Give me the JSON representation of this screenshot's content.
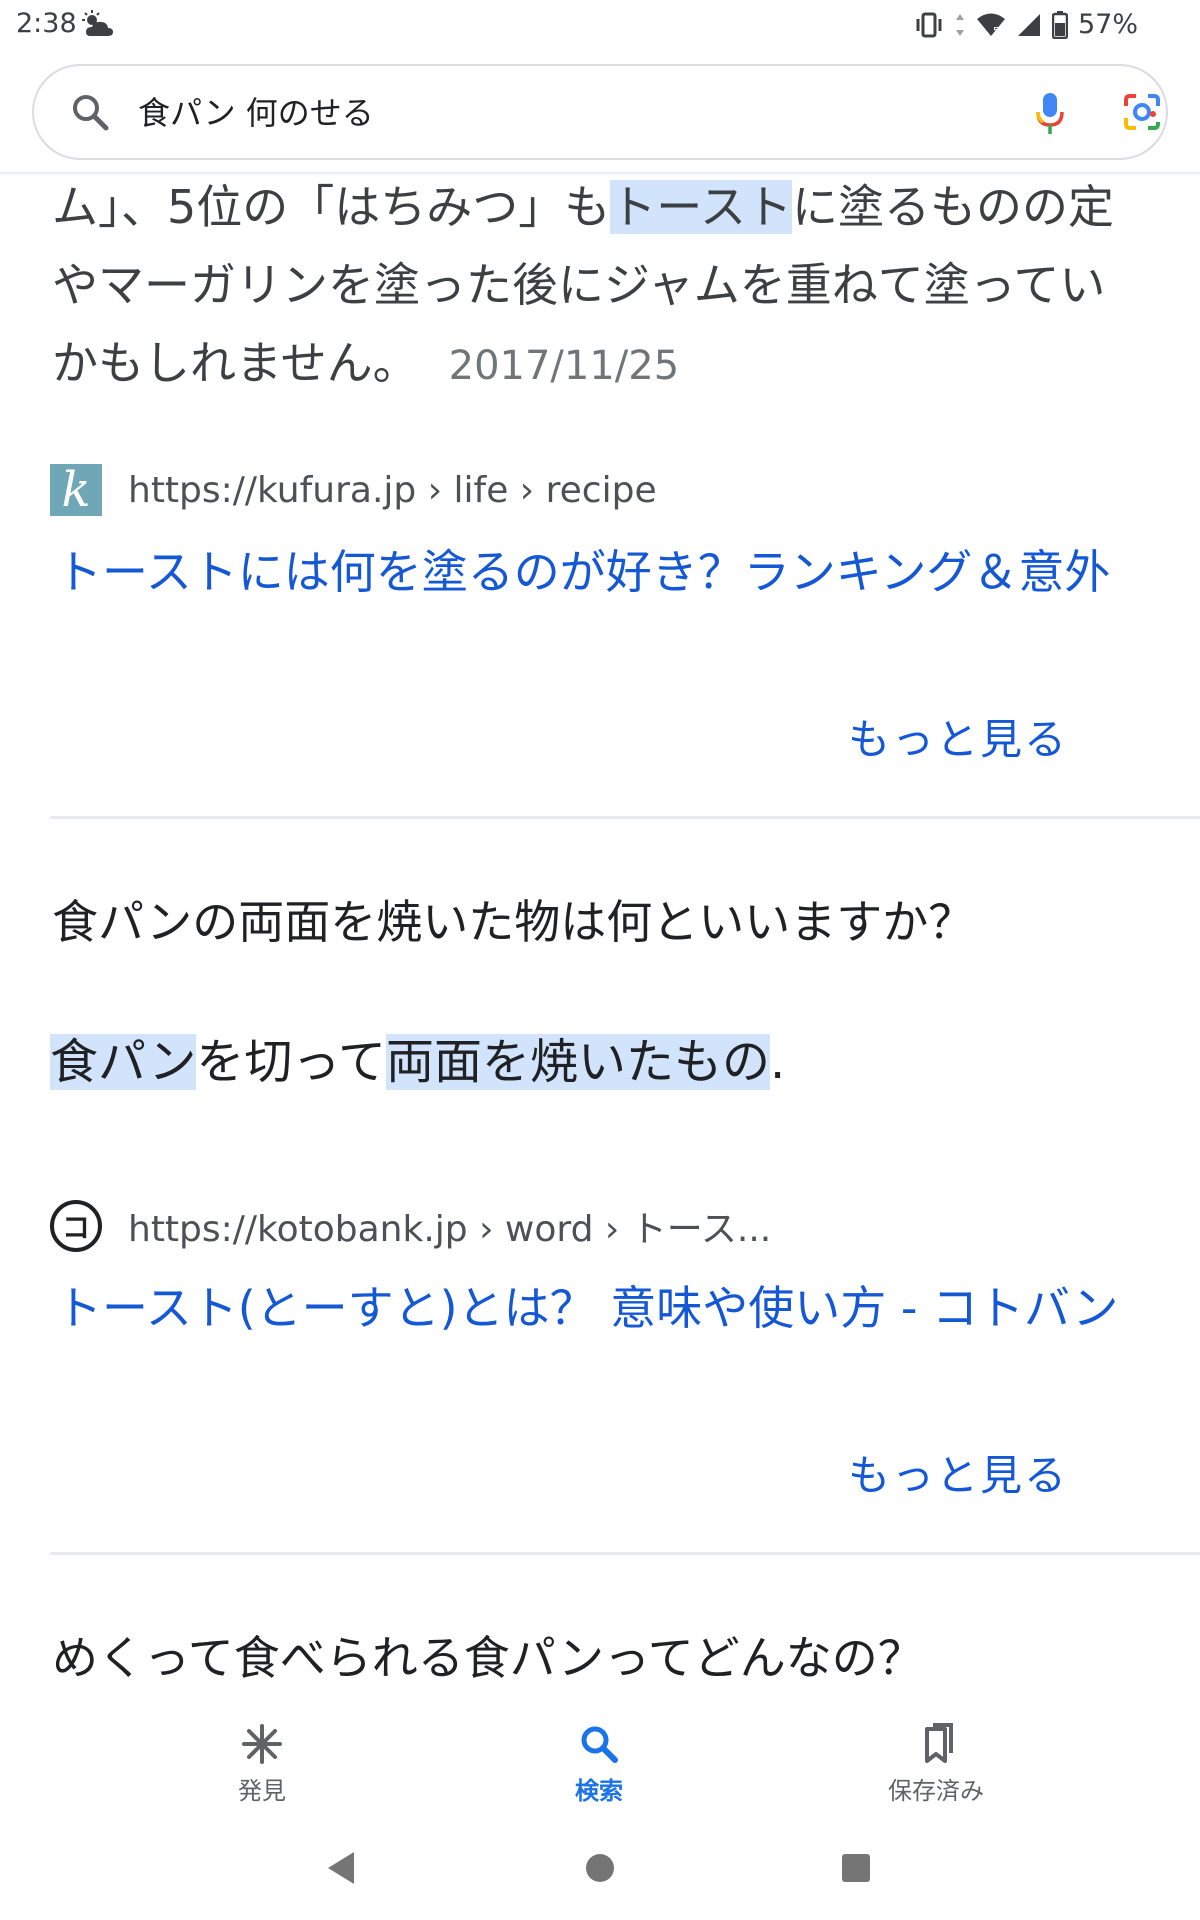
{
  "status_bar": {
    "time": "2:38",
    "battery": "57%"
  },
  "search": {
    "query": "食パン 何のせる",
    "icons": [
      "search-icon",
      "mic-icon",
      "lens-icon"
    ]
  },
  "snippet": {
    "line1_a": "ム」、5位の「はちみつ」も",
    "line1_hl": "トースト",
    "line1_b": "に塗るものの定",
    "line2": "やマーガリンを塗った後にジャムを重ねて塗ってい",
    "line3": "かもしれません。",
    "date": "2017/11/25"
  },
  "result1": {
    "url": "https://kufura.jp › life › recipe",
    "favicon_letter": "k",
    "title": "トーストには何を塗るのが好き？ランキング＆意外",
    "more": "もっと見る"
  },
  "question1": {
    "text": "食パンの両面を焼いた物は何といいますか？",
    "answer_hl1": "食パン",
    "answer_mid": "を切って",
    "answer_hl2": "両面を焼いたもの",
    "answer_end": "."
  },
  "result2": {
    "url": "https://kotobank.jp › word › トース...",
    "favicon_letter": "コ",
    "title": "トースト(とーすと)とは？ 意味や使い方 - コトバン",
    "more": "もっと見る"
  },
  "question2": {
    "text": "めくって食べられる食パンってどんなの？"
  },
  "bottom_nav": {
    "items": [
      {
        "label": "発見",
        "icon": "asterisk-icon"
      },
      {
        "label": "検索",
        "icon": "search-icon"
      },
      {
        "label": "保存済み",
        "icon": "bookmarks-icon"
      }
    ],
    "active": "検索"
  },
  "colors": {
    "link": "#1558d6",
    "highlight": "#d2e3fc",
    "active_nav": "#1a73e8"
  }
}
